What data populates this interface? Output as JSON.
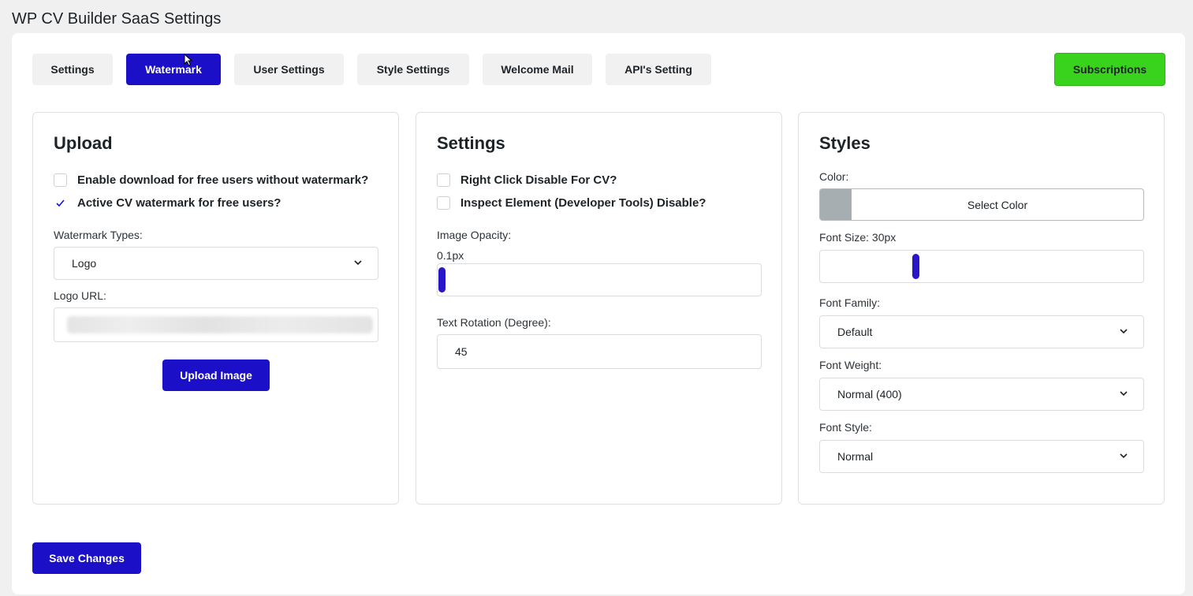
{
  "page_title": "WP CV Builder SaaS Settings",
  "tabs": [
    {
      "label": "Settings",
      "active": false
    },
    {
      "label": "Watermark",
      "active": true
    },
    {
      "label": "User Settings",
      "active": false
    },
    {
      "label": "Style Settings",
      "active": false
    },
    {
      "label": "Welcome Mail",
      "active": false
    },
    {
      "label": "API's Setting",
      "active": false
    }
  ],
  "subscriptions_label": "Subscriptions",
  "upload": {
    "title": "Upload",
    "checkboxes": [
      {
        "label": "Enable download for free users without watermark?",
        "checked": false
      },
      {
        "label": "Active CV watermark for free users?",
        "checked": true
      }
    ],
    "watermark_types_label": "Watermark Types:",
    "watermark_type_value": "Logo",
    "logo_url_label": "Logo URL:",
    "upload_button": "Upload Image"
  },
  "settings": {
    "title": "Settings",
    "checkboxes": [
      {
        "label": "Right Click Disable For CV?",
        "checked": false
      },
      {
        "label": "Inspect Element (Developer Tools) Disable?",
        "checked": false
      }
    ],
    "image_opacity_label": "Image Opacity:",
    "image_opacity_value": "0.1px",
    "image_opacity_slider": 0.0,
    "text_rotation_label": "Text Rotation (Degree):",
    "text_rotation_value": "45"
  },
  "styles": {
    "title": "Styles",
    "color_label": "Color:",
    "color_button": "Select Color",
    "swatch_color": "#a6aeb2",
    "font_size_label": "Font Size: 30px",
    "font_size_slider": 0.29,
    "font_family_label": "Font Family:",
    "font_family_value": "Default",
    "font_weight_label": "Font Weight:",
    "font_weight_value": "Normal (400)",
    "font_style_label": "Font Style:",
    "font_style_value": "Normal"
  },
  "save_button": "Save Changes",
  "colors": {
    "accent": "#1b0fc7",
    "subscriptions": "#39d21c"
  }
}
